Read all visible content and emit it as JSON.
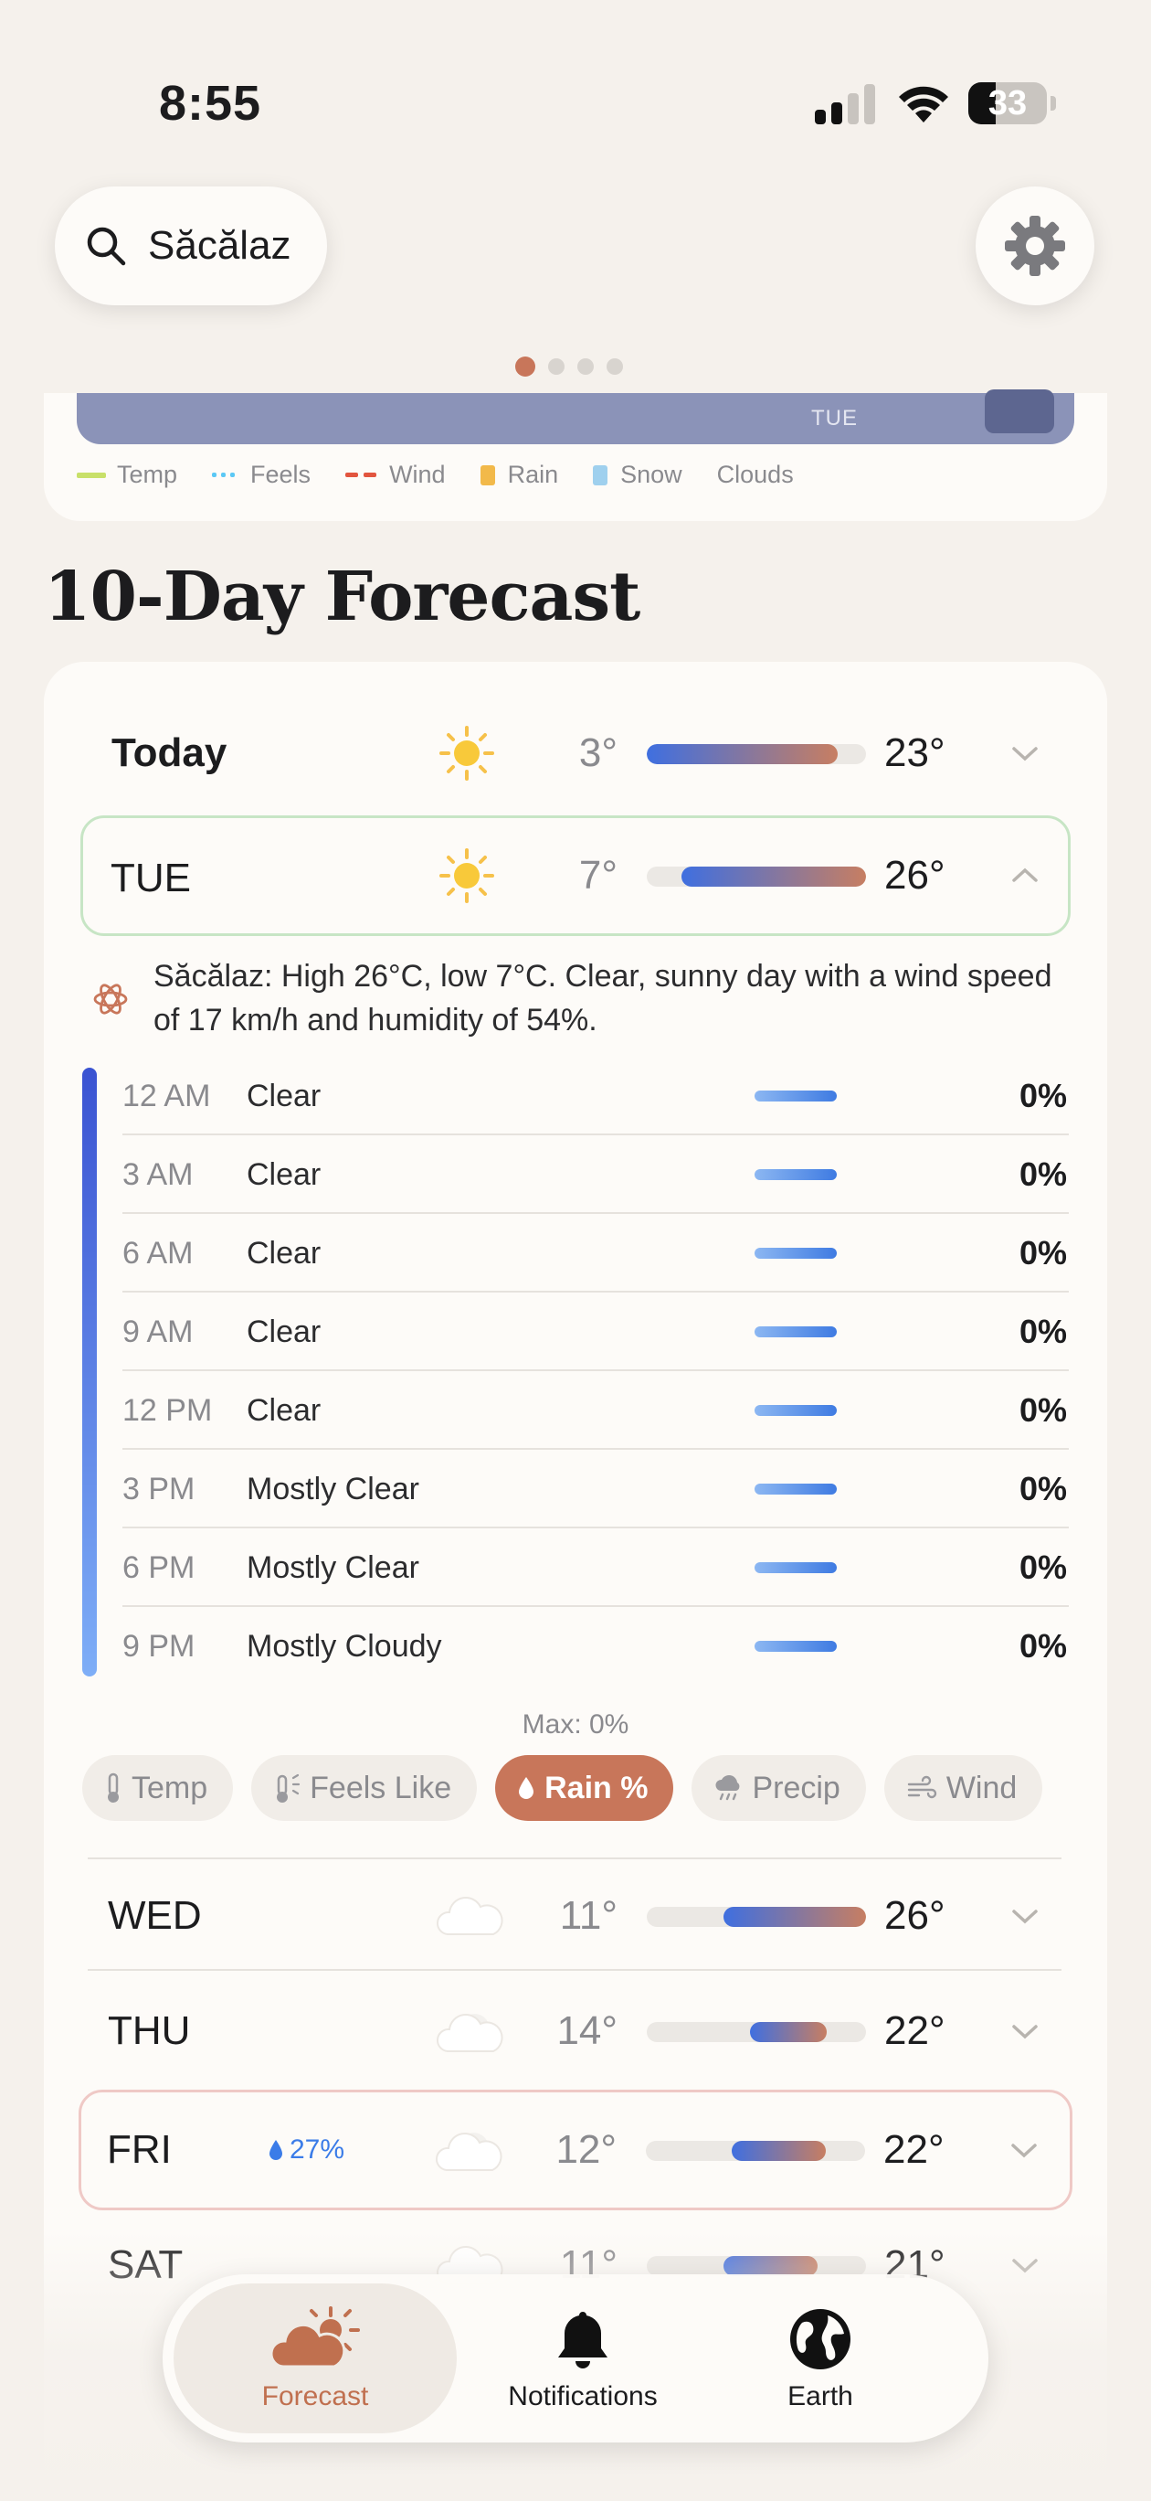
{
  "status": {
    "time": "8:55",
    "battery": "33"
  },
  "search": {
    "location": "Săcălaz"
  },
  "chart_legend": {
    "day_label": "TUE",
    "items": [
      {
        "label": "Temp",
        "color": "#c8e06a"
      },
      {
        "label": "Feels",
        "color": "#5bc8f5"
      },
      {
        "label": "Wind",
        "color": "#e2553f"
      },
      {
        "label": "Rain",
        "color": "#f2b94a"
      },
      {
        "label": "Snow",
        "color": "#9fd0ee"
      },
      {
        "label": "Clouds",
        "color": ""
      }
    ]
  },
  "forecast": {
    "title": "10-Day Forecast",
    "days": [
      {
        "name": "Today",
        "icon": "sun-icon",
        "low": "3°",
        "high": "23°",
        "range": [
          0.0,
          0.87
        ]
      },
      {
        "name": "TUE",
        "icon": "sun-icon",
        "low": "7°",
        "high": "26°",
        "range": [
          0.16,
          1.0
        ],
        "expanded": true
      },
      {
        "name": "WED",
        "icon": "cloud-icon",
        "low": "11°",
        "high": "26°",
        "range": [
          0.35,
          1.0
        ]
      },
      {
        "name": "THU",
        "icon": "cloud-sun-icon",
        "low": "14°",
        "high": "22°",
        "range": [
          0.47,
          0.82
        ]
      },
      {
        "name": "FRI",
        "icon": "cloud-sun-icon",
        "low": "12°",
        "high": "22°",
        "range": [
          0.39,
          0.82
        ],
        "rain": "27%"
      },
      {
        "name": "SAT",
        "icon": "cloud-icon",
        "low": "11°",
        "high": "21°",
        "range": [
          0.35,
          0.78
        ]
      }
    ],
    "summary": "Săcălaz: High 26°C, low 7°C. Clear, sunny day with a wind speed of 17 km/h and humidity of 54%.",
    "hours": [
      {
        "time": "12 AM",
        "cond": "Clear",
        "pct": "0%"
      },
      {
        "time": "3 AM",
        "cond": "Clear",
        "pct": "0%"
      },
      {
        "time": "6 AM",
        "cond": "Clear",
        "pct": "0%"
      },
      {
        "time": "9 AM",
        "cond": "Clear",
        "pct": "0%"
      },
      {
        "time": "12 PM",
        "cond": "Clear",
        "pct": "0%"
      },
      {
        "time": "3 PM",
        "cond": "Mostly Clear",
        "pct": "0%"
      },
      {
        "time": "6 PM",
        "cond": "Mostly Clear",
        "pct": "0%"
      },
      {
        "time": "9 PM",
        "cond": "Mostly Cloudy",
        "pct": "0%"
      }
    ],
    "max_label": "Max: 0%",
    "chips": [
      {
        "label": "Temp",
        "icon": "thermometer-icon",
        "active": false
      },
      {
        "label": "Feels Like",
        "icon": "thermometer-sun-icon",
        "active": false
      },
      {
        "label": "Rain %",
        "icon": "raindrop-icon",
        "active": true
      },
      {
        "label": "Precip",
        "icon": "cloud-rain-icon",
        "active": false
      },
      {
        "label": "Wind",
        "icon": "wind-icon",
        "active": false
      }
    ]
  },
  "tabs": [
    {
      "label": "Forecast",
      "icon": "cloud-sun-icon",
      "active": true
    },
    {
      "label": "Notifications",
      "icon": "bell-icon",
      "active": false
    },
    {
      "label": "Earth",
      "icon": "globe-icon",
      "active": false
    }
  ]
}
